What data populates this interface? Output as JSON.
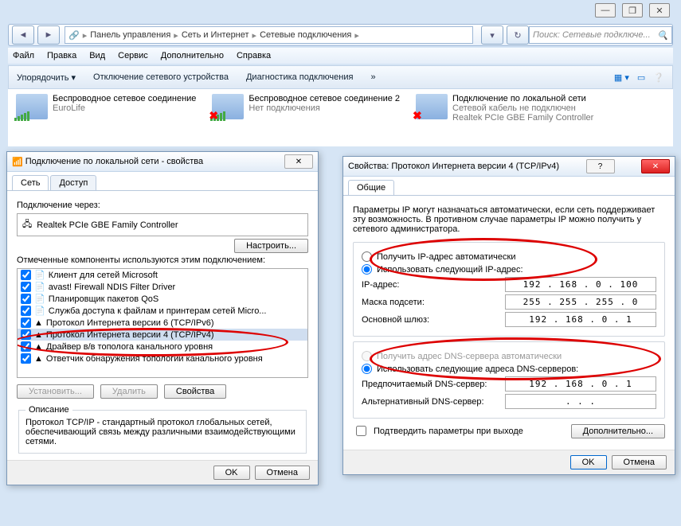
{
  "window_buttons": [
    "—",
    "❐",
    "✕"
  ],
  "breadcrumb": {
    "root": "Панель управления",
    "a": "Сеть и Интернет",
    "b": "Сетевые подключения"
  },
  "search_placeholder": "Поиск: Сетевые подключе...",
  "menu": [
    "Файл",
    "Правка",
    "Вид",
    "Сервис",
    "Дополнительно",
    "Справка"
  ],
  "toolbar": {
    "a": "Упорядочить ▾",
    "b": "Отключение сетевого устройства",
    "c": "Диагностика подключения",
    "d": "»"
  },
  "conns": [
    {
      "title": "Беспроводное сетевое соединение",
      "sub": "EuroLife",
      "status": "ok"
    },
    {
      "title": "Беспроводное сетевое соединение 2",
      "sub": "Нет подключения",
      "status": "x"
    },
    {
      "title": "Подключение по локальной сети",
      "sub": "Сетевой кабель не подключен",
      "sub2": "Realtek PCIe GBE Family Controller",
      "status": "cab"
    }
  ],
  "dlg1": {
    "title": "Подключение по локальной сети - свойства",
    "tabs": [
      "Сеть",
      "Доступ"
    ],
    "connect_via": "Подключение через:",
    "adapter": "Realtek PCIe GBE Family Controller",
    "configure": "Настроить...",
    "components_lbl": "Отмеченные компоненты используются этим подключением:",
    "items": [
      "Клиент для сетей Microsoft",
      "avast! Firewall NDIS Filter Driver",
      "Планировщик пакетов QoS",
      "Служба доступа к файлам и принтерам сетей Micro...",
      "Протокол Интернета версии 6 (TCP/IPv6)",
      "Протокол Интернета версии 4 (TCP/IPv4)",
      "Драйвер в/в тополога канального уровня",
      "Ответчик обнаружения топологии канального уровня"
    ],
    "install": "Установить...",
    "remove": "Удалить",
    "props": "Свойства",
    "desc_title": "Описание",
    "desc": "Протокол TCP/IP - стандартный протокол глобальных сетей, обеспечивающий связь между различными взаимодействующими сетями.",
    "ok": "OK",
    "cancel": "Отмена"
  },
  "dlg2": {
    "title": "Свойства: Протокол Интернета версии 4 (TCP/IPv4)",
    "tab": "Общие",
    "intro": "Параметры IP могут назначаться автоматически, если сеть поддерживает эту возможность. В противном случае параметры IP можно получить у сетевого администратора.",
    "auto_ip": "Получить IP-адрес автоматически",
    "man_ip": "Использовать следующий IP-адрес:",
    "ip_lbl": "IP-адрес:",
    "ip": "192 . 168 .  0  . 100",
    "mask_lbl": "Маска подсети:",
    "mask": "255 . 255 . 255 .  0",
    "gw_lbl": "Основной шлюз:",
    "gw": "192 . 168 .  0  .  1",
    "auto_dns": "Получить адрес DNS-сервера автоматически",
    "man_dns": "Использовать следующие адреса DNS-серверов:",
    "dns1_lbl": "Предпочитаемый DNS-сервер:",
    "dns1": "192 . 168 .  0  .  1",
    "dns2_lbl": "Альтернативный DNS-сервер:",
    "dns2": " .     .     .   ",
    "confirm": "Подтвердить параметры при выходе",
    "adv": "Дополнительно...",
    "ok": "OK",
    "cancel": "Отмена",
    "help": "?"
  }
}
